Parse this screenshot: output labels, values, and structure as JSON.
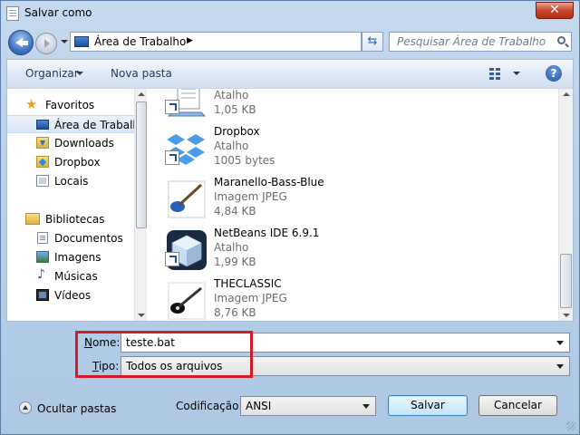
{
  "window": {
    "title": "Salvar como",
    "close_label": "✕"
  },
  "nav": {
    "address": "Área de Trabalho",
    "search_placeholder": "Pesquisar Área de Trabalho"
  },
  "toolbar": {
    "organize_label": "Organizar",
    "new_folder_label": "Nova pasta"
  },
  "sidebar": {
    "favorites_label": "Favoritos",
    "favorites": [
      {
        "label": "Área de Trabalho",
        "icon": "desktop-icon",
        "selected": true
      },
      {
        "label": "Downloads",
        "icon": "downloads-folder-icon"
      },
      {
        "label": "Dropbox",
        "icon": "dropbox-folder-icon"
      },
      {
        "label": "Locais",
        "icon": "recent-places-icon"
      }
    ],
    "libraries_label": "Bibliotecas",
    "libraries": [
      {
        "label": "Documentos",
        "icon": "documents-icon"
      },
      {
        "label": "Imagens",
        "icon": "pictures-icon"
      },
      {
        "label": "Músicas",
        "icon": "music-icon"
      },
      {
        "label": "Vídeos",
        "icon": "videos-icon"
      }
    ]
  },
  "files": [
    {
      "name": "",
      "type": "Atalho",
      "size": "1,05 KB",
      "icon": "shortcut-program-icon"
    },
    {
      "name": "Dropbox",
      "type": "Atalho",
      "size": "1005 bytes",
      "icon": "dropbox-icon"
    },
    {
      "name": "Maranello-Bass-Blue",
      "type": "Imagem JPEG",
      "size": "4,84 KB",
      "icon": "blue-bass-guitar-image-icon"
    },
    {
      "name": "NetBeans IDE 6.9.1",
      "type": "Atalho",
      "size": "1,99 KB",
      "icon": "netbeans-icon"
    },
    {
      "name": "THECLASSIC",
      "type": "Imagem JPEG",
      "size": "8,76 KB",
      "icon": "guitar-image-icon"
    }
  ],
  "form": {
    "name_label_u": "N",
    "name_label_rest": "ome:",
    "name_value": "teste.bat",
    "type_label_u": "T",
    "type_label_rest": "ipo:",
    "type_value": "Todos os arquivos",
    "encoding_label": "Codificação:",
    "encoding_value": "ANSI",
    "hide_folders_label": "Ocultar pastas",
    "save_label": "Salvar",
    "cancel_label": "Cancelar"
  },
  "colors": {
    "highlight_box": "#d01c24",
    "accent": "#3c7fb1"
  }
}
